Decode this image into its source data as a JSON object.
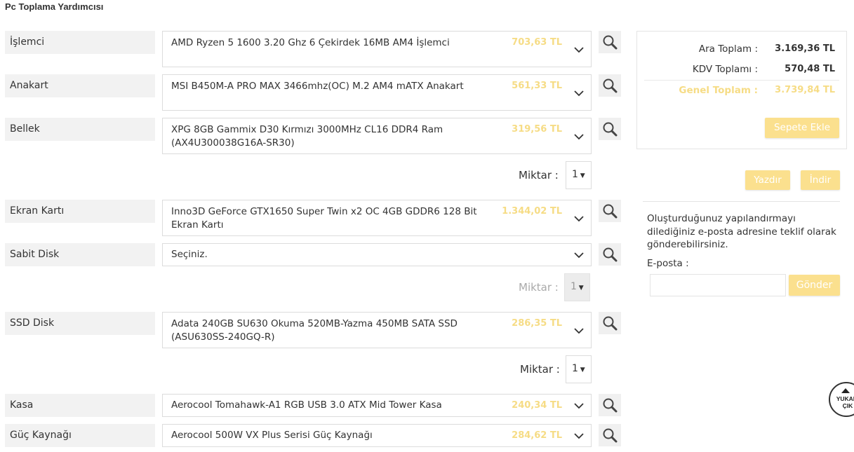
{
  "page": {
    "title": "Pc Toplama Yardımcısı"
  },
  "rows": [
    {
      "label": "İşlemci",
      "product": "AMD Ryzen 5 1600 3.20 Ghz 6 Çekirdek 16MB AM4 İşlemci",
      "price": "703,63 TL"
    },
    {
      "label": "Anakart",
      "product": "MSI B450M-A PRO MAX 3466mhz(OC) M.2 AM4 mATX Anakart",
      "price": "561,33 TL"
    },
    {
      "label": "Bellek",
      "product": "XPG 8GB Gammix D30 Kırmızı 3000MHz CL16 DDR4 Ram (AX4U300038G16A-SR30)",
      "price": "319,56 TL"
    },
    {
      "label": "Ekran Kartı",
      "product": "Inno3D GeForce GTX1650 Super Twin x2 OC 4GB GDDR6 128 Bit Ekran Kartı",
      "price": "1.344,02 TL"
    },
    {
      "label": "Sabit Disk",
      "product": "Seçiniz.",
      "price": ""
    },
    {
      "label": "SSD Disk",
      "product": "Adata 240GB SU630 Okuma 520MB-Yazma 450MB SATA SSD (ASU630SS-240GQ-R)",
      "price": "286,35 TL"
    },
    {
      "label": "Kasa",
      "product": "Aerocool Tomahawk-A1 RGB USB 3.0 ATX Mid Tower Kasa",
      "price": "240,34 TL"
    },
    {
      "label": "Güç Kaynağı",
      "product": "Aerocool 500W VX Plus Serisi Güç Kaynağı",
      "price": "284,62 TL"
    }
  ],
  "quantity": {
    "label": "Miktar :",
    "bellek": "1",
    "sabit_disk": "1",
    "ssd_disk": "1"
  },
  "summary": {
    "subtotal_label": "Ara Toplam :",
    "subtotal_value": "3.169,36 TL",
    "vat_label": "KDV Toplamı :",
    "vat_value": "570,48 TL",
    "total_label": "Genel Toplam :",
    "total_value": "3.739,84 TL",
    "add_to_cart": "Sepete Ekle"
  },
  "actions": {
    "print": "Yazdır",
    "download": "İndir"
  },
  "email": {
    "description": "Oluşturduğunuz yapılandırmayı dilediğiniz e-posta adresine teklif olarak gönderebilirsiniz.",
    "label": "E-posta :",
    "value": "",
    "send": "Gönder"
  },
  "scroll_top": {
    "label": "YUKARI ÇIK",
    "icon": "arrow-up-icon"
  },
  "icons": {
    "search": "search-icon",
    "chevron": "chevron-down-icon"
  },
  "colors": {
    "accent": "#fbe08e",
    "price": "#f6dc85",
    "label_bg": "#f2f2f2"
  }
}
